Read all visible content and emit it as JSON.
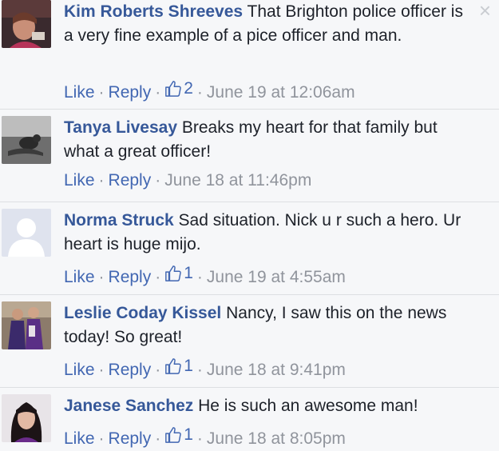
{
  "close_glyph": "×",
  "separator": "·",
  "comments": [
    {
      "name": "Kim Roberts Shreeves",
      "text": " That Brighton police officer is a very fine example of a pice officer and man.",
      "like": "Like",
      "reply": "Reply",
      "likes": "2",
      "time": "June 19 at 12:06am"
    },
    {
      "name": "Tanya Livesay",
      "text": " Breaks my heart for that family but what a great officer!",
      "like": "Like",
      "reply": "Reply",
      "likes": null,
      "time": "June 18 at 11:46pm"
    },
    {
      "name": "Norma Struck",
      "text": " Sad situation. Nick u r such a hero. Ur heart is huge mijo.",
      "like": "Like",
      "reply": "Reply",
      "likes": "1",
      "time": "June 19 at 4:55am"
    },
    {
      "name": "Leslie Coday Kissel",
      "text": " Nancy, I saw this on the news today! So great!",
      "like": "Like",
      "reply": "Reply",
      "likes": "1",
      "time": "June 18 at 9:41pm"
    },
    {
      "name": "Janese Sanchez",
      "text": " He is such an awesome man!",
      "like": "Like",
      "reply": "Reply",
      "likes": "1",
      "time": "June 18 at 8:05pm"
    }
  ],
  "colors": {
    "name": "#365899",
    "link": "#4267b2",
    "meta": "#90949c",
    "background": "#f6f7f9",
    "separator": "#dddfe2"
  },
  "icons": [
    "close-icon",
    "thumbs-up-icon",
    "avatar-photo",
    "default-avatar-silhouette"
  ]
}
